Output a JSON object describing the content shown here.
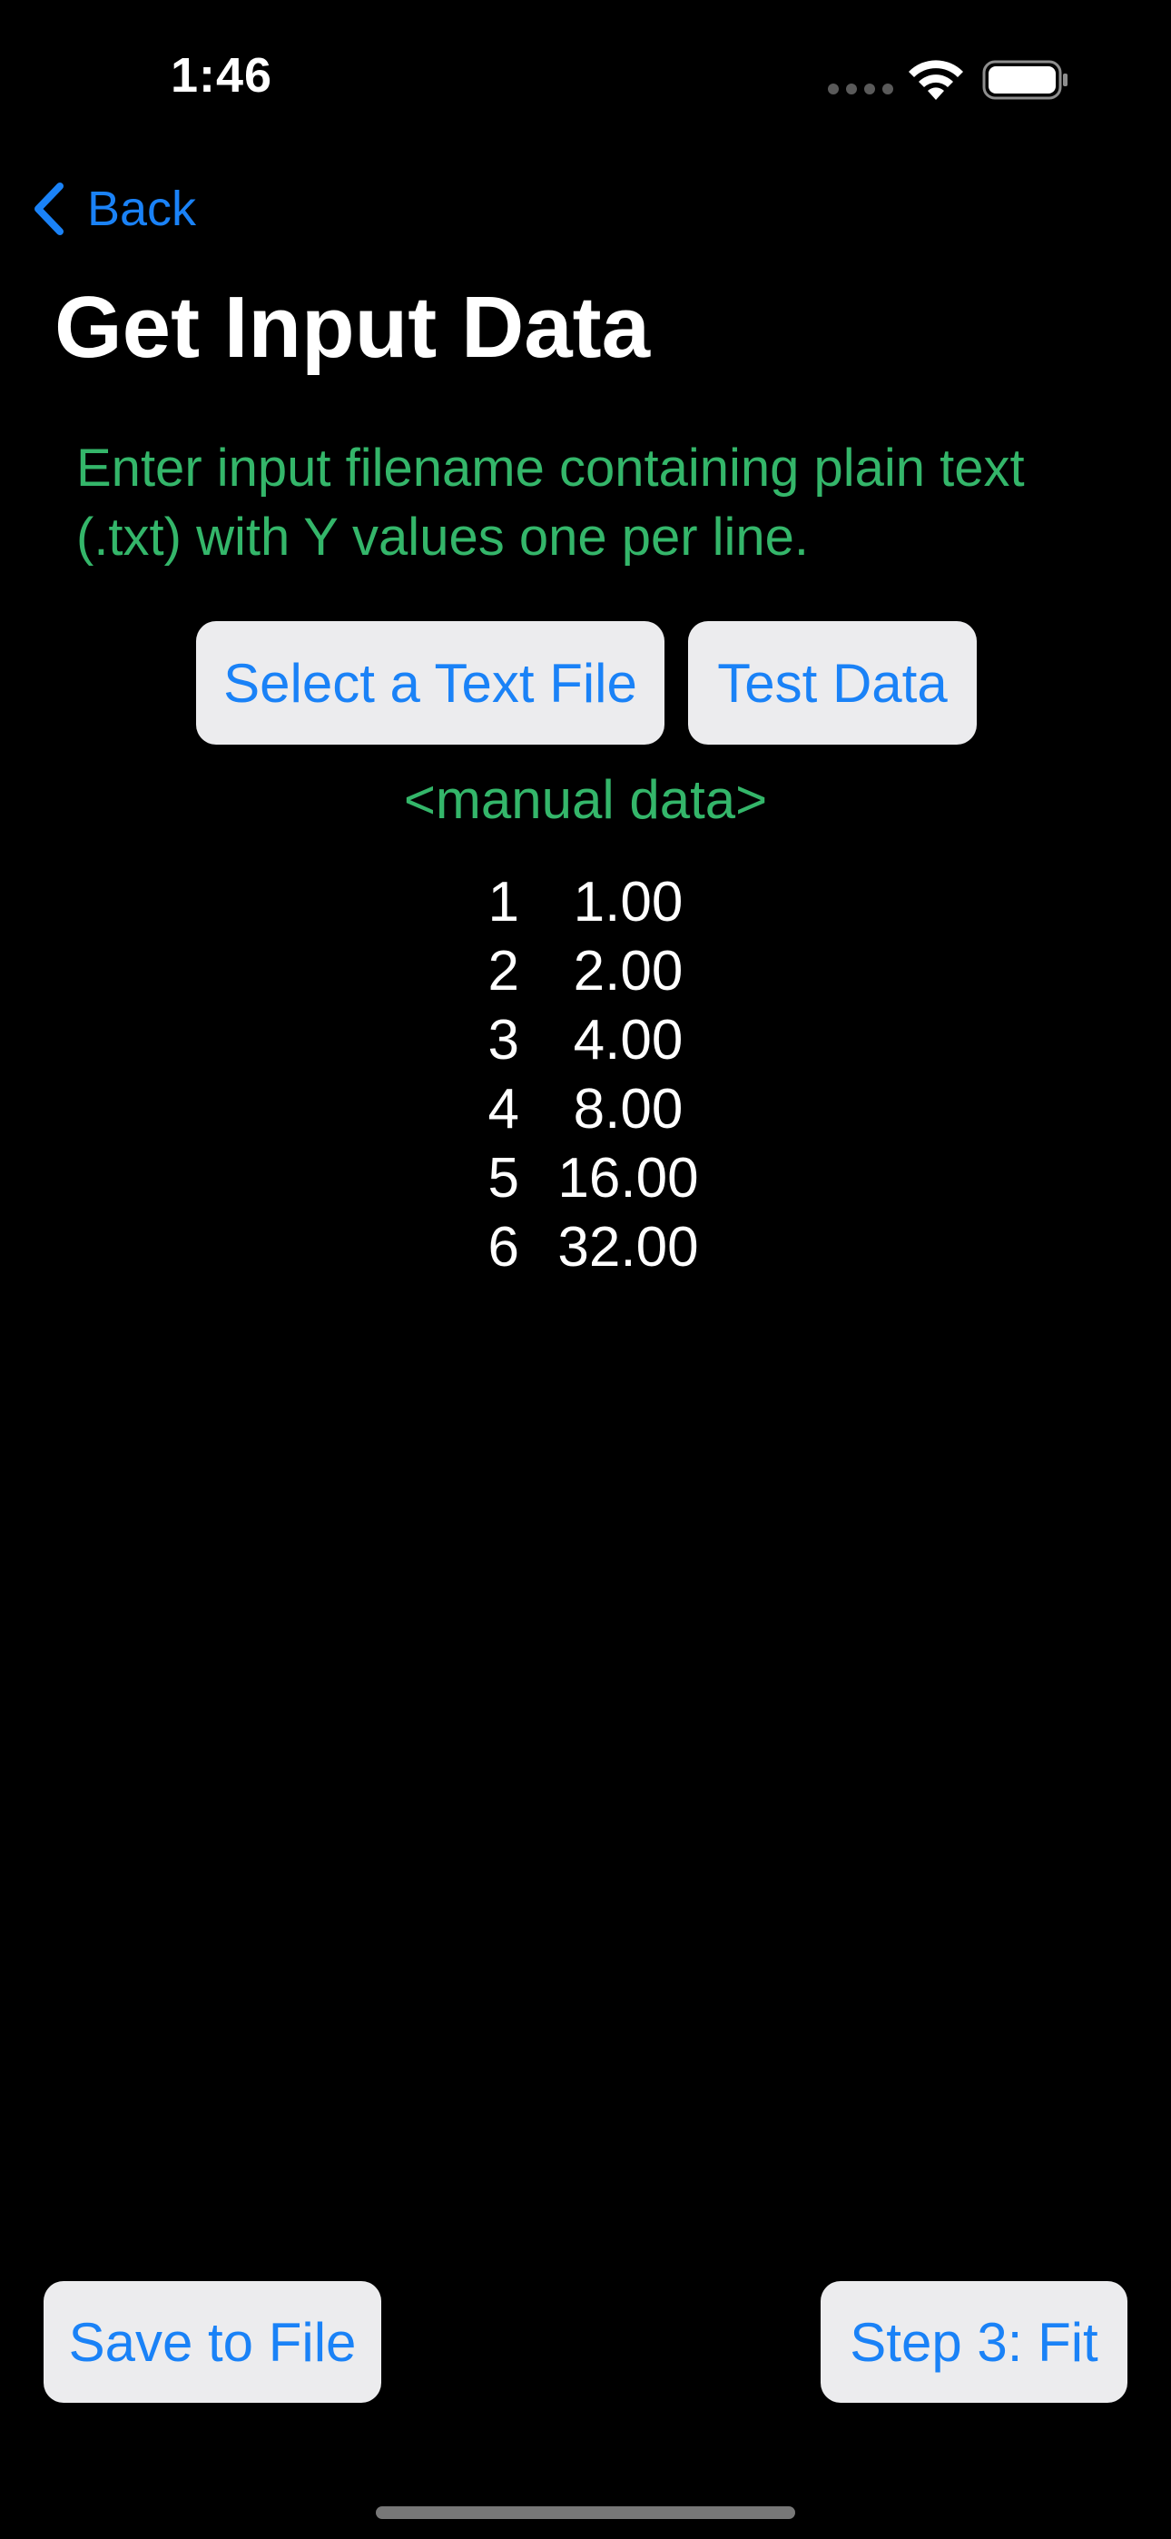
{
  "status_bar": {
    "time": "1:46"
  },
  "nav": {
    "back_label": "Back"
  },
  "page": {
    "title": "Get Input Data",
    "instructions": "Enter input filename containing plain text (.txt) with Y values one per line."
  },
  "buttons": {
    "select_file": "Select a Text File",
    "test_data": "Test Data",
    "save_to_file": "Save to File",
    "step3_fit": "Step 3: Fit"
  },
  "data_source": "<manual data>",
  "data_rows": [
    {
      "index": "1",
      "value": "1.00"
    },
    {
      "index": "2",
      "value": "2.00"
    },
    {
      "index": "3",
      "value": "4.00"
    },
    {
      "index": "4",
      "value": "8.00"
    },
    {
      "index": "5",
      "value": "16.00"
    },
    {
      "index": "6",
      "value": "32.00"
    }
  ],
  "colors": {
    "background": "#000000",
    "accent_blue": "#1a82f7",
    "green_text": "#34b66a",
    "button_bg": "#ececee"
  },
  "icons": {
    "back": "chevron-left-icon",
    "wifi": "wifi-icon",
    "battery": "battery-icon",
    "signal": "cellular-signal-icon"
  }
}
